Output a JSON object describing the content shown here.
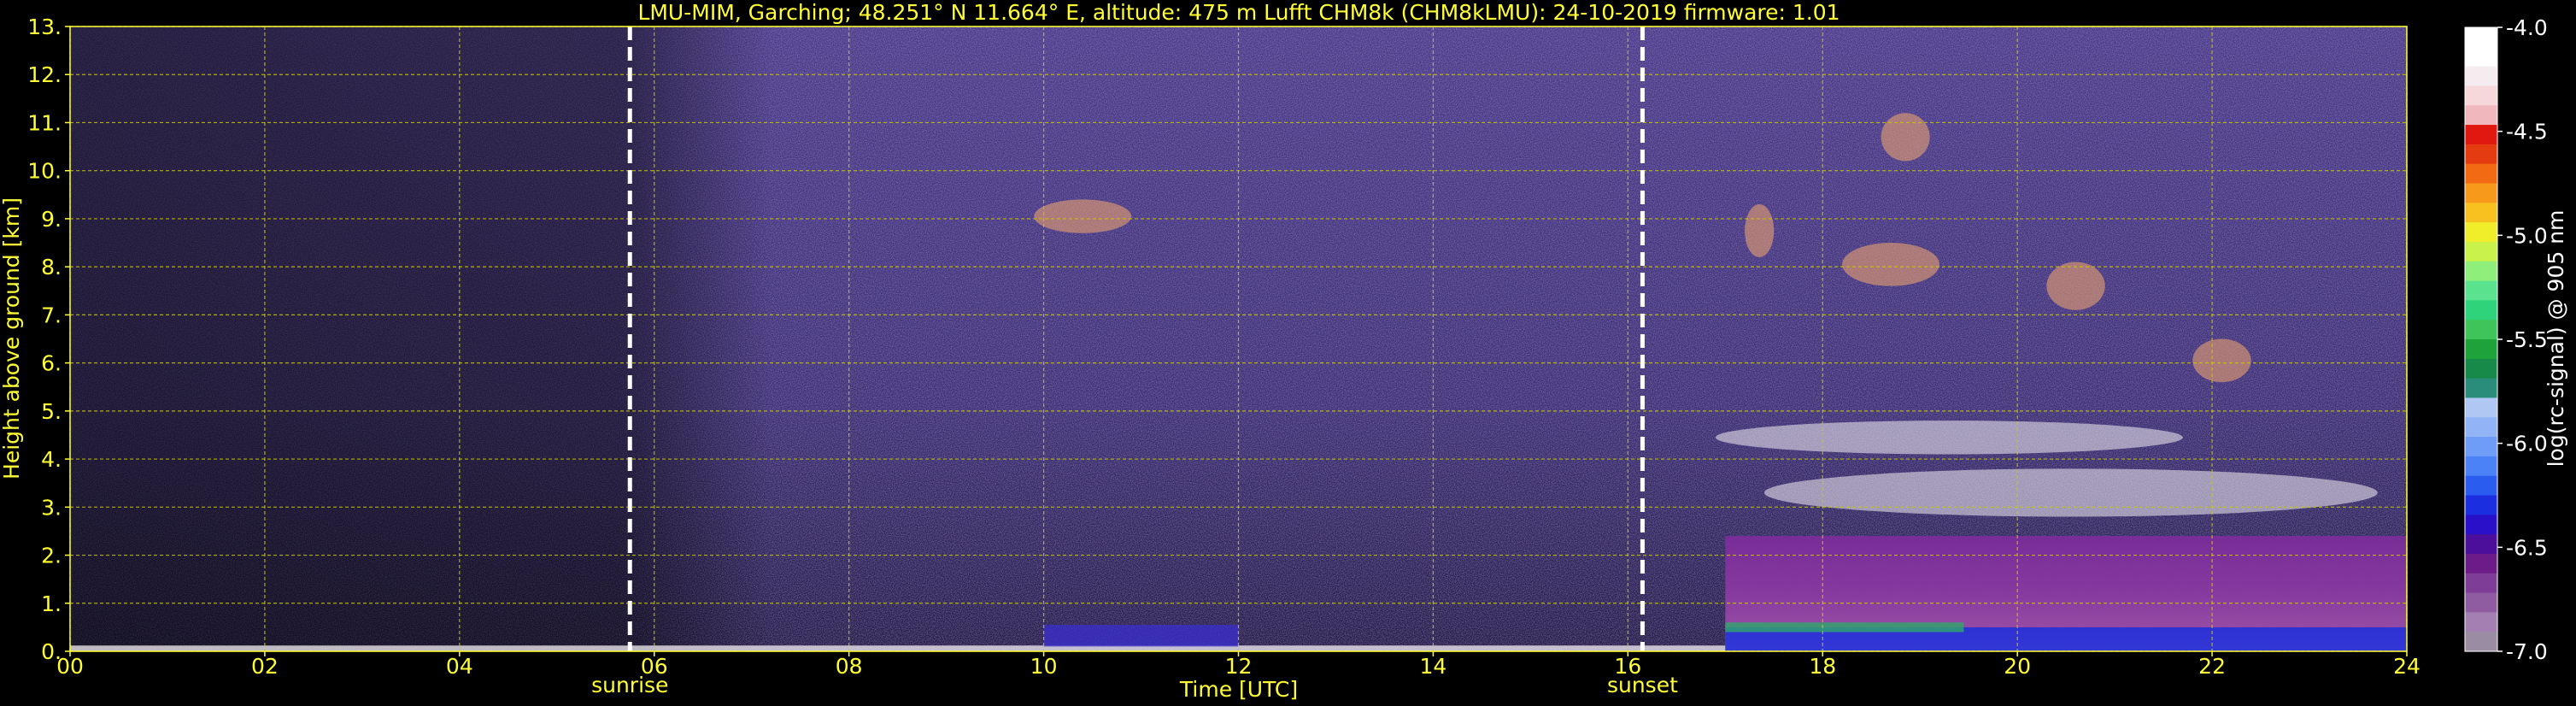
{
  "chart_data": {
    "type": "heatmap",
    "title": "LMU-MIM, Garching; 48.251° N 11.664° E, altitude: 475 m    Lufft CHM8k (CHM8kLMU): 24-10-2019    firmware: 1.01",
    "xlabel": "Time [UTC]",
    "ylabel": "Height above ground [km]",
    "xlim": [
      0,
      24
    ],
    "ylim": [
      0,
      13
    ],
    "x_ticks": [
      "00",
      "02",
      "04",
      "06",
      "08",
      "10",
      "12",
      "14",
      "16",
      "18",
      "20",
      "22",
      "24"
    ],
    "y_ticks": [
      "0.",
      "1.",
      "2.",
      "3.",
      "4.",
      "5.",
      "6.",
      "7.",
      "8.",
      "9.",
      "10.",
      "11.",
      "12.",
      "13."
    ],
    "grid": true,
    "events": [
      {
        "label": "sunrise",
        "time": 5.75
      },
      {
        "label": "sunset",
        "time": 16.15
      }
    ],
    "colorbar": {
      "label": "log(rc-signal) @ 905 nm",
      "range": [
        -7.0,
        -4.0
      ],
      "ticks": [
        "-4.0",
        "-4.5",
        "-5.0",
        "-5.5",
        "-6.0",
        "-6.5",
        "-7.0"
      ],
      "colors": [
        "#9a8ca3",
        "#a37fb2",
        "#8f5ba1",
        "#7e3d96",
        "#6c1c87",
        "#4b0f9b",
        "#2a10c8",
        "#1b2ee0",
        "#2a5cf0",
        "#4b82f5",
        "#6e9df7",
        "#90b4f5",
        "#b1c7f3",
        "#2a8c7a",
        "#178a4a",
        "#1ea23a",
        "#3fc45a",
        "#2fd47a",
        "#5ae28f",
        "#8ef07a",
        "#c9f24a",
        "#f0ee2a",
        "#f7c21f",
        "#f79a1c",
        "#f26b12",
        "#e43b10",
        "#e01810",
        "#f0b7bd",
        "#f6d7da",
        "#f4ecee",
        "#ffffff",
        "#ffffff"
      ]
    },
    "features": [
      {
        "type": "cloud",
        "t_start": 9.9,
        "t_end": 10.9,
        "h_bottom": 8.7,
        "h_top": 9.4
      },
      {
        "type": "cloud",
        "t_start": 17.2,
        "t_end": 17.5,
        "h_bottom": 8.2,
        "h_top": 9.3
      },
      {
        "type": "cloud",
        "t_start": 18.2,
        "t_end": 19.2,
        "h_bottom": 7.6,
        "h_top": 8.5
      },
      {
        "type": "cloud",
        "t_start": 18.6,
        "t_end": 19.1,
        "h_bottom": 10.2,
        "h_top": 11.2
      },
      {
        "type": "cloud",
        "t_start": 20.3,
        "t_end": 20.9,
        "h_bottom": 7.1,
        "h_top": 8.1
      },
      {
        "type": "cloud",
        "t_start": 21.8,
        "t_end": 22.4,
        "h_bottom": 5.6,
        "h_top": 6.5
      },
      {
        "type": "cloud",
        "t_start": 16.9,
        "t_end": 21.7,
        "h_bottom": 4.1,
        "h_top": 4.8
      },
      {
        "type": "cloud",
        "t_start": 17.4,
        "t_end": 23.7,
        "h_bottom": 2.8,
        "h_top": 3.8
      },
      {
        "type": "aerosol_layer",
        "t_start": 17.0,
        "t_end": 24.0,
        "h_bottom": 0.0,
        "h_top": 2.4
      }
    ]
  }
}
